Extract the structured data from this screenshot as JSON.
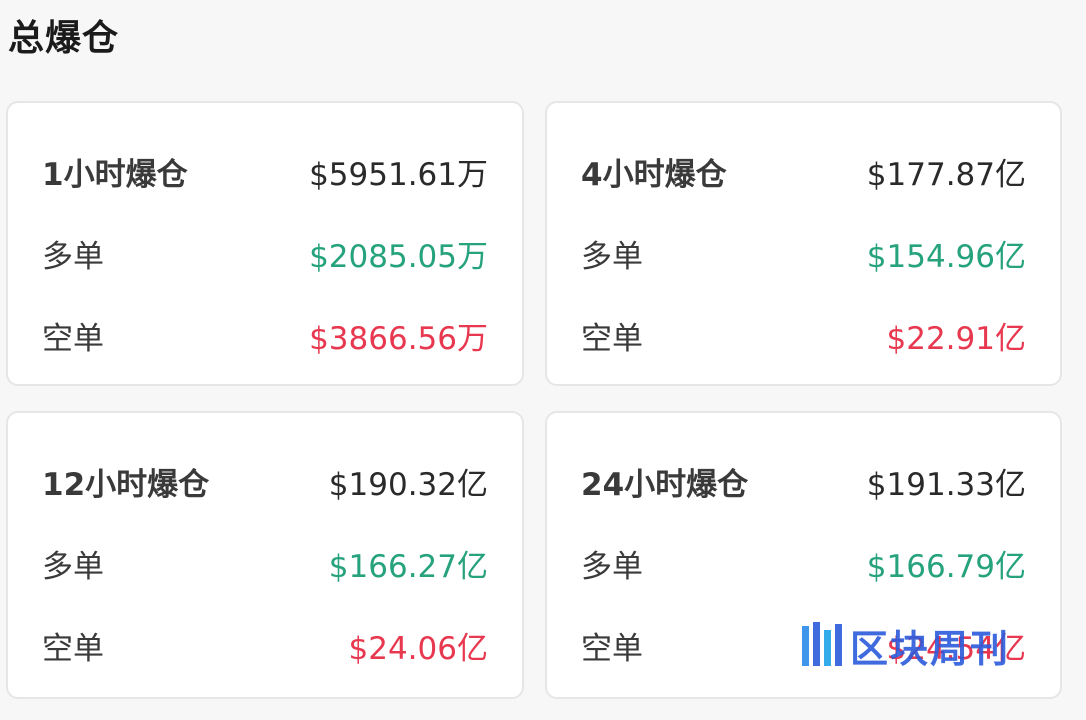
{
  "page_title": "总爆仓",
  "cards": [
    {
      "title": "1小时爆仓",
      "total": "$5951.61万",
      "long_label": "多单",
      "long_value": "$2085.05万",
      "short_label": "空单",
      "short_value": "$3866.56万"
    },
    {
      "title": "4小时爆仓",
      "total": "$177.87亿",
      "long_label": "多单",
      "long_value": "$154.96亿",
      "short_label": "空单",
      "short_value": "$22.91亿"
    },
    {
      "title": "12小时爆仓",
      "total": "$190.32亿",
      "long_label": "多单",
      "long_value": "$166.27亿",
      "short_label": "空单",
      "short_value": "$24.06亿"
    },
    {
      "title": "24小时爆仓",
      "total": "$191.33亿",
      "long_label": "多单",
      "long_value": "$166.79亿",
      "short_label": "空单",
      "short_value": "$24.54亿"
    }
  ],
  "watermark": {
    "text": "区块周刊"
  },
  "colors": {
    "long": "#26a27d",
    "short": "#e8384f",
    "watermark": "#2b5bdc"
  }
}
